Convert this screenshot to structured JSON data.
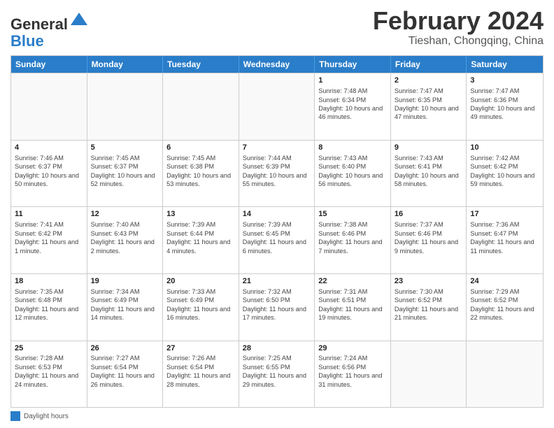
{
  "header": {
    "logo_line1": "General",
    "logo_line2": "Blue",
    "month_title": "February 2024",
    "location": "Tieshan, Chongqing, China"
  },
  "days_of_week": [
    "Sunday",
    "Monday",
    "Tuesday",
    "Wednesday",
    "Thursday",
    "Friday",
    "Saturday"
  ],
  "weeks": [
    [
      {
        "day": "",
        "sunrise": "",
        "sunset": "",
        "daylight": ""
      },
      {
        "day": "",
        "sunrise": "",
        "sunset": "",
        "daylight": ""
      },
      {
        "day": "",
        "sunrise": "",
        "sunset": "",
        "daylight": ""
      },
      {
        "day": "",
        "sunrise": "",
        "sunset": "",
        "daylight": ""
      },
      {
        "day": "1",
        "sunrise": "Sunrise: 7:48 AM",
        "sunset": "Sunset: 6:34 PM",
        "daylight": "Daylight: 10 hours and 46 minutes."
      },
      {
        "day": "2",
        "sunrise": "Sunrise: 7:47 AM",
        "sunset": "Sunset: 6:35 PM",
        "daylight": "Daylight: 10 hours and 47 minutes."
      },
      {
        "day": "3",
        "sunrise": "Sunrise: 7:47 AM",
        "sunset": "Sunset: 6:36 PM",
        "daylight": "Daylight: 10 hours and 49 minutes."
      }
    ],
    [
      {
        "day": "4",
        "sunrise": "Sunrise: 7:46 AM",
        "sunset": "Sunset: 6:37 PM",
        "daylight": "Daylight: 10 hours and 50 minutes."
      },
      {
        "day": "5",
        "sunrise": "Sunrise: 7:45 AM",
        "sunset": "Sunset: 6:37 PM",
        "daylight": "Daylight: 10 hours and 52 minutes."
      },
      {
        "day": "6",
        "sunrise": "Sunrise: 7:45 AM",
        "sunset": "Sunset: 6:38 PM",
        "daylight": "Daylight: 10 hours and 53 minutes."
      },
      {
        "day": "7",
        "sunrise": "Sunrise: 7:44 AM",
        "sunset": "Sunset: 6:39 PM",
        "daylight": "Daylight: 10 hours and 55 minutes."
      },
      {
        "day": "8",
        "sunrise": "Sunrise: 7:43 AM",
        "sunset": "Sunset: 6:40 PM",
        "daylight": "Daylight: 10 hours and 56 minutes."
      },
      {
        "day": "9",
        "sunrise": "Sunrise: 7:43 AM",
        "sunset": "Sunset: 6:41 PM",
        "daylight": "Daylight: 10 hours and 58 minutes."
      },
      {
        "day": "10",
        "sunrise": "Sunrise: 7:42 AM",
        "sunset": "Sunset: 6:42 PM",
        "daylight": "Daylight: 10 hours and 59 minutes."
      }
    ],
    [
      {
        "day": "11",
        "sunrise": "Sunrise: 7:41 AM",
        "sunset": "Sunset: 6:42 PM",
        "daylight": "Daylight: 11 hours and 1 minute."
      },
      {
        "day": "12",
        "sunrise": "Sunrise: 7:40 AM",
        "sunset": "Sunset: 6:43 PM",
        "daylight": "Daylight: 11 hours and 2 minutes."
      },
      {
        "day": "13",
        "sunrise": "Sunrise: 7:39 AM",
        "sunset": "Sunset: 6:44 PM",
        "daylight": "Daylight: 11 hours and 4 minutes."
      },
      {
        "day": "14",
        "sunrise": "Sunrise: 7:39 AM",
        "sunset": "Sunset: 6:45 PM",
        "daylight": "Daylight: 11 hours and 6 minutes."
      },
      {
        "day": "15",
        "sunrise": "Sunrise: 7:38 AM",
        "sunset": "Sunset: 6:46 PM",
        "daylight": "Daylight: 11 hours and 7 minutes."
      },
      {
        "day": "16",
        "sunrise": "Sunrise: 7:37 AM",
        "sunset": "Sunset: 6:46 PM",
        "daylight": "Daylight: 11 hours and 9 minutes."
      },
      {
        "day": "17",
        "sunrise": "Sunrise: 7:36 AM",
        "sunset": "Sunset: 6:47 PM",
        "daylight": "Daylight: 11 hours and 11 minutes."
      }
    ],
    [
      {
        "day": "18",
        "sunrise": "Sunrise: 7:35 AM",
        "sunset": "Sunset: 6:48 PM",
        "daylight": "Daylight: 11 hours and 12 minutes."
      },
      {
        "day": "19",
        "sunrise": "Sunrise: 7:34 AM",
        "sunset": "Sunset: 6:49 PM",
        "daylight": "Daylight: 11 hours and 14 minutes."
      },
      {
        "day": "20",
        "sunrise": "Sunrise: 7:33 AM",
        "sunset": "Sunset: 6:49 PM",
        "daylight": "Daylight: 11 hours and 16 minutes."
      },
      {
        "day": "21",
        "sunrise": "Sunrise: 7:32 AM",
        "sunset": "Sunset: 6:50 PM",
        "daylight": "Daylight: 11 hours and 17 minutes."
      },
      {
        "day": "22",
        "sunrise": "Sunrise: 7:31 AM",
        "sunset": "Sunset: 6:51 PM",
        "daylight": "Daylight: 11 hours and 19 minutes."
      },
      {
        "day": "23",
        "sunrise": "Sunrise: 7:30 AM",
        "sunset": "Sunset: 6:52 PM",
        "daylight": "Daylight: 11 hours and 21 minutes."
      },
      {
        "day": "24",
        "sunrise": "Sunrise: 7:29 AM",
        "sunset": "Sunset: 6:52 PM",
        "daylight": "Daylight: 11 hours and 22 minutes."
      }
    ],
    [
      {
        "day": "25",
        "sunrise": "Sunrise: 7:28 AM",
        "sunset": "Sunset: 6:53 PM",
        "daylight": "Daylight: 11 hours and 24 minutes."
      },
      {
        "day": "26",
        "sunrise": "Sunrise: 7:27 AM",
        "sunset": "Sunset: 6:54 PM",
        "daylight": "Daylight: 11 hours and 26 minutes."
      },
      {
        "day": "27",
        "sunrise": "Sunrise: 7:26 AM",
        "sunset": "Sunset: 6:54 PM",
        "daylight": "Daylight: 11 hours and 28 minutes."
      },
      {
        "day": "28",
        "sunrise": "Sunrise: 7:25 AM",
        "sunset": "Sunset: 6:55 PM",
        "daylight": "Daylight: 11 hours and 29 minutes."
      },
      {
        "day": "29",
        "sunrise": "Sunrise: 7:24 AM",
        "sunset": "Sunset: 6:56 PM",
        "daylight": "Daylight: 11 hours and 31 minutes."
      },
      {
        "day": "",
        "sunrise": "",
        "sunset": "",
        "daylight": ""
      },
      {
        "day": "",
        "sunrise": "",
        "sunset": "",
        "daylight": ""
      }
    ]
  ],
  "footer": {
    "legend_label": "Daylight hours"
  }
}
